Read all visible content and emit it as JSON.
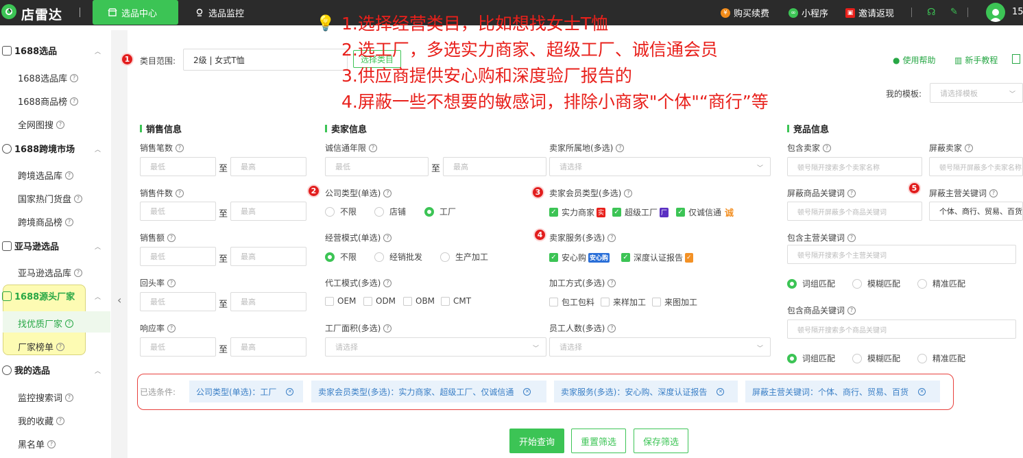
{
  "topbar": {
    "brand": "店雷达",
    "tabs": [
      {
        "label": "选品中心",
        "active": true
      },
      {
        "label": "选品监控",
        "active": false
      }
    ],
    "actions": [
      {
        "label": "购买续费",
        "icon": "yen-icon",
        "color": "#f18b19"
      },
      {
        "label": "小程序",
        "icon": "miniprogram-icon",
        "color": "#3cc455"
      },
      {
        "label": "邀请返现",
        "icon": "gift-icon",
        "color": "#e8201b"
      }
    ],
    "user_count": "15"
  },
  "sidebar": {
    "groups": [
      {
        "label": "1688选品",
        "items": [
          {
            "label": "1688选品库"
          },
          {
            "label": "1688商品榜"
          },
          {
            "label": "全网图搜"
          }
        ]
      },
      {
        "label": "1688跨境市场",
        "items": [
          {
            "label": "跨境选品库"
          },
          {
            "label": "国家热门货盘"
          },
          {
            "label": "跨境商品榜"
          }
        ]
      },
      {
        "label": "亚马逊选品",
        "items": [
          {
            "label": "亚马逊选品库"
          }
        ]
      },
      {
        "label": "1688源头厂家",
        "items": [
          {
            "label": "找优质厂家"
          },
          {
            "label": "厂家榜单"
          }
        ]
      },
      {
        "label": "我的选品",
        "items": [
          {
            "label": "监控搜索词"
          },
          {
            "label": "我的收藏"
          },
          {
            "label": "黑名单"
          }
        ]
      }
    ]
  },
  "category": {
    "label": "类目范围:",
    "value": "2级 | 女式T恤",
    "button": "选择类目"
  },
  "help": {
    "help_label": "使用帮助",
    "tutorial_label": "新手教程"
  },
  "template": {
    "label": "我的模板:",
    "placeholder": "请选择模板"
  },
  "annotations": [
    "1.选择经营类目，比如想找女士T恤",
    "2.选工厂，多选实力商家、超级工厂、诚信通会员",
    "3.供应商提供安心购和深度验厂报告的",
    "4.屏蔽一些不想要的敏感词，排除小商家\"个体\"“商行”等"
  ],
  "badges": [
    "1",
    "2",
    "3",
    "4",
    "5"
  ],
  "sales": {
    "title": "销售信息",
    "fields": [
      {
        "label": "销售笔数"
      },
      {
        "label": "销售件数"
      },
      {
        "label": "销售额"
      },
      {
        "label": "回头率"
      },
      {
        "label": "响应率"
      }
    ],
    "min_placeholder": "最低",
    "max_placeholder": "最高",
    "to": "至"
  },
  "seller": {
    "title": "卖家信息",
    "years": {
      "label": "诚信通年限"
    },
    "company_type": {
      "label": "公司类型(单选)",
      "options": [
        "不限",
        "店铺",
        "工厂"
      ],
      "selected": 2
    },
    "business_mode": {
      "label": "经营模式(单选)",
      "options": [
        "不限",
        "经销批发",
        "生产加工"
      ],
      "selected": 0
    },
    "oem": {
      "label": "代工模式(多选)",
      "options": [
        "OEM",
        "ODM",
        "OBM",
        "CMT"
      ]
    },
    "factory_area": {
      "label": "工厂面积(多选)",
      "placeholder": "请选择"
    },
    "location": {
      "label": "卖家所属地(多选)",
      "placeholder": "请选择"
    },
    "member_type": {
      "label": "卖家会员类型(多选)",
      "options": [
        {
          "label": "实力商家",
          "badge": "实",
          "color": "#e8201b"
        },
        {
          "label": "超级工厂",
          "badge": "厂",
          "color": "#5a2fc2"
        },
        {
          "label": "仅诚信通",
          "badge": "诚",
          "color": "#f39125"
        }
      ]
    },
    "service": {
      "label": "卖家服务(多选)",
      "options": [
        {
          "label": "安心购",
          "badge": "安心购",
          "color": "#2a6fd8"
        },
        {
          "label": "深度认证报告",
          "badge": "✓",
          "color": "#f39125"
        }
      ]
    },
    "process": {
      "label": "加工方式(多选)",
      "options": [
        "包工包料",
        "来样加工",
        "来图加工"
      ]
    },
    "employees": {
      "label": "员工人数(多选)",
      "placeholder": "请选择"
    }
  },
  "competitor": {
    "title": "竞品信息",
    "include_seller": {
      "label": "包含卖家",
      "placeholder": "顿号隔开搜索多个卖家名称"
    },
    "block_seller": {
      "label": "屏蔽卖家",
      "placeholder": "顿号隔开屏蔽多个卖家名称"
    },
    "block_product_kw": {
      "label": "屏蔽商品关键词",
      "placeholder": "顿号隔开屏蔽多个商品关键词"
    },
    "block_main_kw": {
      "label": "屏蔽主营关键词",
      "value": "个体、商行、贸易、百货"
    },
    "include_main_kw": {
      "label": "包含主营关键词",
      "placeholder": "顿号隔开搜索多个主营关键词"
    },
    "match_options": [
      "词组匹配",
      "模糊匹配",
      "精准匹配"
    ],
    "include_product_kw": {
      "label": "包含商品关键词",
      "placeholder": "顿号隔开搜索多个商品关键词"
    }
  },
  "selected": {
    "label": "已选条件:",
    "chips": [
      "公司类型(单选)：工厂",
      "卖家会员类型(多选)：实力商家、超级工厂、仅诚信通",
      "卖家服务(多选)：安心购、深度认证报告",
      "屏蔽主营关键词：个体、商行、贸易、百货"
    ]
  },
  "buttons": {
    "query": "开始查询",
    "reset": "重置筛选",
    "save": "保存筛选"
  },
  "colors": {
    "brand": "#3cc455",
    "annotation": "#e8201b",
    "chip_text": "#3a7fc6"
  }
}
